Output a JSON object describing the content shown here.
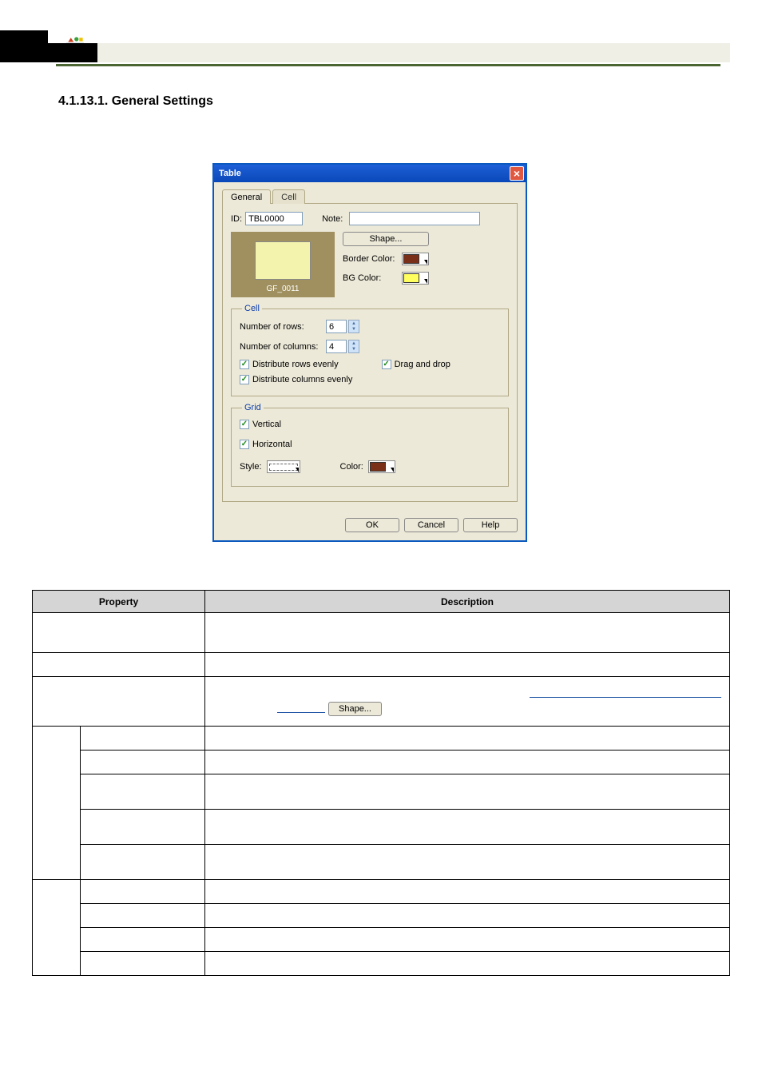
{
  "heading": "4.1.13.1.  General Settings",
  "dialog": {
    "title": "Table",
    "tabs": {
      "general": "General",
      "cell": "Cell"
    },
    "id_label": "ID:",
    "id_value": "TBL0000",
    "note_label": "Note:",
    "note_value": "",
    "shape_btn": "Shape...",
    "border_color_label": "Border Color:",
    "bg_color_label": "BG Color:",
    "preview_name": "GF_0011",
    "cell_group": "Cell",
    "num_rows_label": "Number of rows:",
    "num_rows_value": "6",
    "num_cols_label": "Number of columns:",
    "num_cols_value": "4",
    "dist_rows": "Distribute rows evenly",
    "dist_cols": "Distribute columns evenly",
    "drag_drop": "Drag and drop",
    "grid_group": "Grid",
    "vertical": "Vertical",
    "horizontal": "Horizontal",
    "style_label": "Style:",
    "color_label": "Color:",
    "ok": "OK",
    "cancel": "Cancel",
    "help": "Help"
  },
  "colors": {
    "border_color": "#7a3018",
    "bg_color": "#ffff60",
    "grid_color": "#7a3018"
  },
  "table": {
    "col_property": "Property",
    "col_description": "Description"
  }
}
